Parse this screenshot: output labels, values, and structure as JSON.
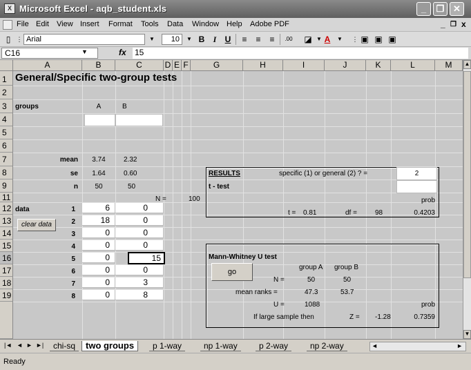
{
  "window": {
    "title": "Microsoft Excel - aqb_student.xls",
    "minimize": "_",
    "restore": "❐",
    "close": "✕"
  },
  "menu": {
    "items": [
      "File",
      "Edit",
      "View",
      "Insert",
      "Format",
      "Tools",
      "Data",
      "Window",
      "Help",
      "Adobe PDF"
    ],
    "mdi_min": "_",
    "mdi_restore": "❐",
    "mdi_close": "x"
  },
  "toolbar": {
    "font": "Arial",
    "size": "10",
    "bold": "B",
    "italic": "I",
    "underline": "U",
    "font_color_label": "A"
  },
  "formula_bar": {
    "name_box": "C16",
    "fx": "fx",
    "value": "15"
  },
  "columns": [
    "A",
    "B",
    "C",
    "D",
    "E",
    "F",
    "G",
    "H",
    "I",
    "J",
    "K",
    "L",
    "M"
  ],
  "rows": [
    "1",
    "2",
    "3",
    "4",
    "5",
    "6",
    "7",
    "8",
    "9",
    "11",
    "12",
    "13",
    "14",
    "15",
    "16",
    "17",
    "18",
    "19"
  ],
  "sheet": {
    "title": "General/Specific two-group tests",
    "groups_label": "groups",
    "group_a": "A",
    "group_b": "B",
    "mean_label": "mean",
    "mean_a": "3.74",
    "mean_b": "2.32",
    "se_label": "se",
    "se_a": "1.64",
    "se_b": "0.60",
    "n_label": "n",
    "n_a": "50",
    "n_b": "50",
    "N_label": "N =",
    "N_value": "100",
    "data_label": "data",
    "clear_data": "clear data",
    "data_rows": [
      {
        "idx": "1",
        "a": "6",
        "b": "0"
      },
      {
        "idx": "2",
        "a": "18",
        "b": "0"
      },
      {
        "idx": "3",
        "a": "0",
        "b": "0"
      },
      {
        "idx": "4",
        "a": "0",
        "b": "0"
      },
      {
        "idx": "5",
        "a": "0",
        "b": "15"
      },
      {
        "idx": "6",
        "a": "0",
        "b": "0"
      },
      {
        "idx": "7",
        "a": "0",
        "b": "3"
      },
      {
        "idx": "8",
        "a": "0",
        "b": "8"
      }
    ]
  },
  "results": {
    "header": "RESULTS",
    "question": "specific (1) or general (2) ? =",
    "choice": "2",
    "ttest_label": "t - test",
    "prob_label": "prob",
    "t_label": "t =",
    "t_value": "0.81",
    "df_label": "df =",
    "df_value": "98",
    "prob_value": "0.4203"
  },
  "mann_whitney": {
    "header": "Mann-Whitney U test",
    "group_a": "group A",
    "group_b": "group B",
    "go": "go",
    "n_label": "N =",
    "n_a": "50",
    "n_b": "50",
    "mean_ranks_label": "mean ranks =",
    "mean_rank_a": "47.3",
    "mean_rank_b": "53.7",
    "u_label": "U =",
    "u_value": "1088",
    "prob_label": "prob",
    "large_sample": "If large sample then",
    "z_label": "Z =",
    "z_value": "-1.28",
    "prob_value": "0.7359"
  },
  "tabs": [
    "chi-sq",
    "two groups",
    "p 1-way",
    "np 1-way",
    "p 2-way",
    "np 2-way"
  ],
  "active_tab": "two groups",
  "status": "Ready"
}
